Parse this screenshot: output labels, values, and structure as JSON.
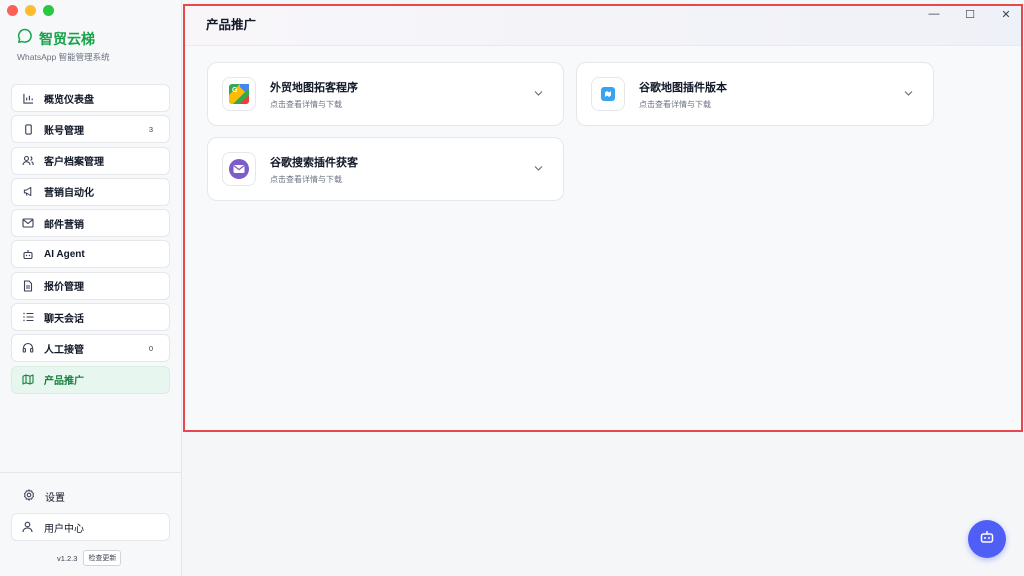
{
  "brand": {
    "title": "智贸云梯",
    "subtitle": "WhatsApp 智能管理系统"
  },
  "nav": [
    {
      "label": "概览仪表盘",
      "icon": "bar-chart-icon",
      "badge": ""
    },
    {
      "label": "账号管理",
      "icon": "phone-icon",
      "badge": "3"
    },
    {
      "label": "客户档案管理",
      "icon": "users-icon",
      "badge": ""
    },
    {
      "label": "营销自动化",
      "icon": "megaphone-icon",
      "badge": ""
    },
    {
      "label": "邮件营销",
      "icon": "mail-icon",
      "badge": ""
    },
    {
      "label": "AI Agent",
      "icon": "bot-icon",
      "badge": ""
    },
    {
      "label": "报价管理",
      "icon": "document-icon",
      "badge": ""
    },
    {
      "label": "聊天会话",
      "icon": "list-icon",
      "badge": ""
    },
    {
      "label": "人工接管",
      "icon": "headset-icon",
      "badge": "0"
    },
    {
      "label": "产品推广",
      "icon": "map-icon",
      "badge": "",
      "active": true
    }
  ],
  "footer": {
    "settings": "设置",
    "user_center": "用户中心",
    "version": "v1.2.3",
    "check_update": "检查更新"
  },
  "page": {
    "title": "产品推广"
  },
  "cards": [
    {
      "name": "外贸地图拓客程序",
      "desc": "点击查看详情与下载",
      "icon": "google-maps-icon"
    },
    {
      "name": "谷歌地图插件版本",
      "desc": "点击查看详情与下载",
      "icon": "map-plugin-icon"
    },
    {
      "name": "谷歌搜索插件获客",
      "desc": "点击查看详情与下载",
      "icon": "mail-plugin-icon"
    }
  ],
  "colors": {
    "accent": "#16a34a",
    "active_bg": "#e7f6ee",
    "fab": "#4f5ff6",
    "highlight": "#e5484d"
  }
}
